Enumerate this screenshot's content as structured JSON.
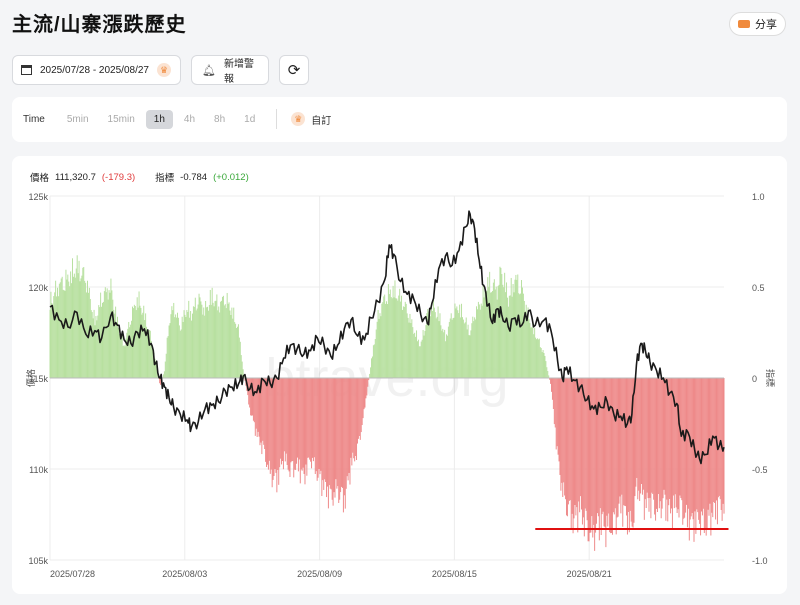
{
  "page": {
    "title": "主流/山寨漲跌歷史",
    "share_label": "分享"
  },
  "toolbar": {
    "date_range": "2025/07/28 - 2025/08/27",
    "alert_label": "新增警報"
  },
  "timeframes": {
    "label": "Time",
    "items": [
      "5min",
      "15min",
      "1h",
      "4h",
      "8h",
      "1d"
    ],
    "active": "1h",
    "custom_label": "自訂"
  },
  "legend": {
    "price_label": "價格",
    "price_value": "111,320.7",
    "price_change": "(-179.3)",
    "index_label": "指標",
    "index_value": "-0.784",
    "index_change": "(+0.012)"
  },
  "watermark": "btrave.org",
  "colors": {
    "price_line": "#1a1a1a",
    "positive_bar": "#b8e0a0",
    "negative_bar": "#ee8a8a",
    "marker_line": "#e01010"
  },
  "chart_data": {
    "type": "line",
    "y_left_label": "價格",
    "y_right_label": "指標",
    "y_left_ticks": [
      "125k",
      "120k",
      "115k",
      "110k",
      "105k"
    ],
    "y_left_range": [
      105000,
      125000
    ],
    "y_right_ticks": [
      "1.0",
      "0.5",
      "0",
      "-0.5",
      "-1.0"
    ],
    "y_right_range": [
      -1,
      1
    ],
    "x_ticks": [
      "2025/07/28",
      "2025/08/03",
      "2025/08/09",
      "2025/08/15",
      "2025/08/21"
    ],
    "x_range_days": [
      0,
      30
    ],
    "price_series": [
      [
        0.0,
        118900
      ],
      [
        0.4,
        118200
      ],
      [
        0.8,
        117800
      ],
      [
        1.2,
        118600
      ],
      [
        1.6,
        117400
      ],
      [
        2.0,
        117600
      ],
      [
        2.3,
        117200
      ],
      [
        2.7,
        118400
      ],
      [
        3.0,
        117900
      ],
      [
        3.3,
        117100
      ],
      [
        3.6,
        116900
      ],
      [
        3.9,
        117500
      ],
      [
        4.2,
        117700
      ],
      [
        4.5,
        116900
      ],
      [
        4.7,
        115800
      ],
      [
        4.9,
        115000
      ],
      [
        5.1,
        114500
      ],
      [
        5.3,
        113900
      ],
      [
        5.5,
        113400
      ],
      [
        5.8,
        113000
      ],
      [
        6.1,
        112700
      ],
      [
        6.3,
        112300
      ],
      [
        6.6,
        112600
      ],
      [
        6.9,
        113300
      ],
      [
        7.2,
        113500
      ],
      [
        7.5,
        113700
      ],
      [
        7.8,
        114300
      ],
      [
        8.1,
        114500
      ],
      [
        8.4,
        114700
      ],
      [
        8.6,
        115100
      ],
      [
        8.9,
        114400
      ],
      [
        9.2,
        114200
      ],
      [
        9.5,
        114900
      ],
      [
        9.8,
        114700
      ],
      [
        10.1,
        115000
      ],
      [
        10.4,
        116100
      ],
      [
        10.7,
        116800
      ],
      [
        11.0,
        116600
      ],
      [
        11.3,
        116300
      ],
      [
        11.6,
        116500
      ],
      [
        11.9,
        117200
      ],
      [
        12.2,
        116800
      ],
      [
        12.5,
        116200
      ],
      [
        12.8,
        116800
      ],
      [
        13.1,
        117700
      ],
      [
        13.4,
        118200
      ],
      [
        13.7,
        117300
      ],
      [
        14.0,
        117100
      ],
      [
        14.3,
        118300
      ],
      [
        14.6,
        119200
      ],
      [
        14.9,
        120400
      ],
      [
        15.1,
        122300
      ],
      [
        15.3,
        121800
      ],
      [
        15.6,
        120300
      ],
      [
        15.9,
        119600
      ],
      [
        16.2,
        119300
      ],
      [
        16.5,
        118500
      ],
      [
        16.8,
        118000
      ],
      [
        17.0,
        119100
      ],
      [
        17.3,
        121000
      ],
      [
        17.6,
        121700
      ],
      [
        17.9,
        121200
      ],
      [
        18.2,
        122000
      ],
      [
        18.5,
        123300
      ],
      [
        18.7,
        124000
      ],
      [
        18.9,
        123200
      ],
      [
        19.1,
        121500
      ],
      [
        19.3,
        120100
      ],
      [
        19.5,
        119000
      ],
      [
        19.7,
        118000
      ],
      [
        19.9,
        118800
      ],
      [
        20.1,
        118500
      ],
      [
        20.4,
        117800
      ],
      [
        20.7,
        118300
      ],
      [
        21.0,
        117900
      ],
      [
        21.3,
        118700
      ],
      [
        21.6,
        117900
      ],
      [
        22.0,
        118200
      ],
      [
        22.3,
        117600
      ],
      [
        22.6,
        115900
      ],
      [
        22.8,
        115000
      ],
      [
        23.0,
        115600
      ],
      [
        23.3,
        114900
      ],
      [
        23.6,
        114500
      ],
      [
        23.9,
        113800
      ],
      [
        24.2,
        113300
      ],
      [
        24.5,
        113400
      ],
      [
        24.8,
        113700
      ],
      [
        25.1,
        113000
      ],
      [
        25.4,
        112900
      ],
      [
        25.7,
        112500
      ],
      [
        25.9,
        113000
      ],
      [
        26.1,
        115700
      ],
      [
        26.3,
        116900
      ],
      [
        26.5,
        116500
      ],
      [
        26.7,
        115900
      ],
      [
        27.0,
        115400
      ],
      [
        27.3,
        115000
      ],
      [
        27.6,
        114200
      ],
      [
        27.9,
        113600
      ],
      [
        28.1,
        111800
      ],
      [
        28.4,
        112000
      ],
      [
        28.7,
        111000
      ],
      [
        28.9,
        110600
      ],
      [
        29.2,
        110800
      ],
      [
        29.5,
        111800
      ],
      [
        29.8,
        111300
      ],
      [
        30.0,
        111200
      ]
    ],
    "index_envelope": [
      [
        0.0,
        0.48
      ],
      [
        0.4,
        0.58
      ],
      [
        0.8,
        0.62
      ],
      [
        1.2,
        0.7
      ],
      [
        1.6,
        0.62
      ],
      [
        2.0,
        0.35
      ],
      [
        2.3,
        0.5
      ],
      [
        2.7,
        0.57
      ],
      [
        3.0,
        0.35
      ],
      [
        3.3,
        0.2
      ],
      [
        3.6,
        0.38
      ],
      [
        3.9,
        0.5
      ],
      [
        4.2,
        0.4
      ],
      [
        4.5,
        0.25
      ],
      [
        4.7,
        0.1
      ],
      [
        4.9,
        -0.05
      ],
      [
        5.1,
        0.05
      ],
      [
        5.3,
        0.35
      ],
      [
        5.5,
        0.45
      ],
      [
        5.8,
        0.32
      ],
      [
        6.1,
        0.44
      ],
      [
        6.3,
        0.4
      ],
      [
        6.6,
        0.5
      ],
      [
        6.9,
        0.42
      ],
      [
        7.2,
        0.52
      ],
      [
        7.5,
        0.45
      ],
      [
        7.8,
        0.5
      ],
      [
        8.1,
        0.42
      ],
      [
        8.4,
        0.3
      ],
      [
        8.6,
        0.05
      ],
      [
        8.9,
        -0.2
      ],
      [
        9.2,
        -0.35
      ],
      [
        9.5,
        -0.45
      ],
      [
        9.8,
        -0.6
      ],
      [
        10.1,
        -0.65
      ],
      [
        10.4,
        -0.5
      ],
      [
        10.7,
        -0.58
      ],
      [
        11.0,
        -0.55
      ],
      [
        11.3,
        -0.62
      ],
      [
        11.6,
        -0.5
      ],
      [
        11.9,
        -0.6
      ],
      [
        12.2,
        -0.68
      ],
      [
        12.5,
        -0.75
      ],
      [
        12.8,
        -0.7
      ],
      [
        13.1,
        -0.78
      ],
      [
        13.4,
        -0.55
      ],
      [
        13.7,
        -0.45
      ],
      [
        14.0,
        -0.2
      ],
      [
        14.3,
        0.1
      ],
      [
        14.6,
        0.38
      ],
      [
        14.9,
        0.5
      ],
      [
        15.1,
        0.53
      ],
      [
        15.3,
        0.55
      ],
      [
        15.6,
        0.5
      ],
      [
        15.9,
        0.42
      ],
      [
        16.2,
        0.3
      ],
      [
        16.5,
        0.2
      ],
      [
        16.8,
        0.4
      ],
      [
        17.0,
        0.45
      ],
      [
        17.3,
        0.4
      ],
      [
        17.6,
        0.25
      ],
      [
        17.9,
        0.4
      ],
      [
        18.2,
        0.45
      ],
      [
        18.5,
        0.35
      ],
      [
        18.7,
        0.28
      ],
      [
        18.9,
        0.4
      ],
      [
        19.1,
        0.45
      ],
      [
        19.3,
        0.52
      ],
      [
        19.5,
        0.6
      ],
      [
        19.7,
        0.58
      ],
      [
        19.9,
        0.55
      ],
      [
        20.1,
        0.68
      ],
      [
        20.4,
        0.5
      ],
      [
        20.7,
        0.62
      ],
      [
        21.0,
        0.56
      ],
      [
        21.3,
        0.38
      ],
      [
        21.6,
        0.28
      ],
      [
        22.0,
        0.15
      ],
      [
        22.3,
        -0.05
      ],
      [
        22.6,
        -0.5
      ],
      [
        22.8,
        -0.7
      ],
      [
        23.0,
        -0.8
      ],
      [
        23.3,
        -0.9
      ],
      [
        23.6,
        -0.82
      ],
      [
        23.9,
        -0.95
      ],
      [
        24.2,
        -0.98
      ],
      [
        24.5,
        -0.9
      ],
      [
        24.8,
        -0.95
      ],
      [
        25.1,
        -0.92
      ],
      [
        25.4,
        -0.8
      ],
      [
        25.7,
        -0.88
      ],
      [
        25.9,
        -0.95
      ],
      [
        26.1,
        -0.7
      ],
      [
        26.3,
        -0.72
      ],
      [
        26.5,
        -0.8
      ],
      [
        26.7,
        -0.78
      ],
      [
        27.0,
        -0.83
      ],
      [
        27.3,
        -0.78
      ],
      [
        27.6,
        -0.85
      ],
      [
        27.9,
        -0.8
      ],
      [
        28.1,
        -0.82
      ],
      [
        28.4,
        -0.9
      ],
      [
        28.7,
        -0.92
      ],
      [
        28.9,
        -0.88
      ],
      [
        29.2,
        -0.93
      ],
      [
        29.5,
        -0.85
      ],
      [
        29.8,
        -0.8
      ],
      [
        30.0,
        -0.82
      ]
    ],
    "marker_line": {
      "x_start": 21.6,
      "x_end": 30.2,
      "value": -0.83
    }
  }
}
